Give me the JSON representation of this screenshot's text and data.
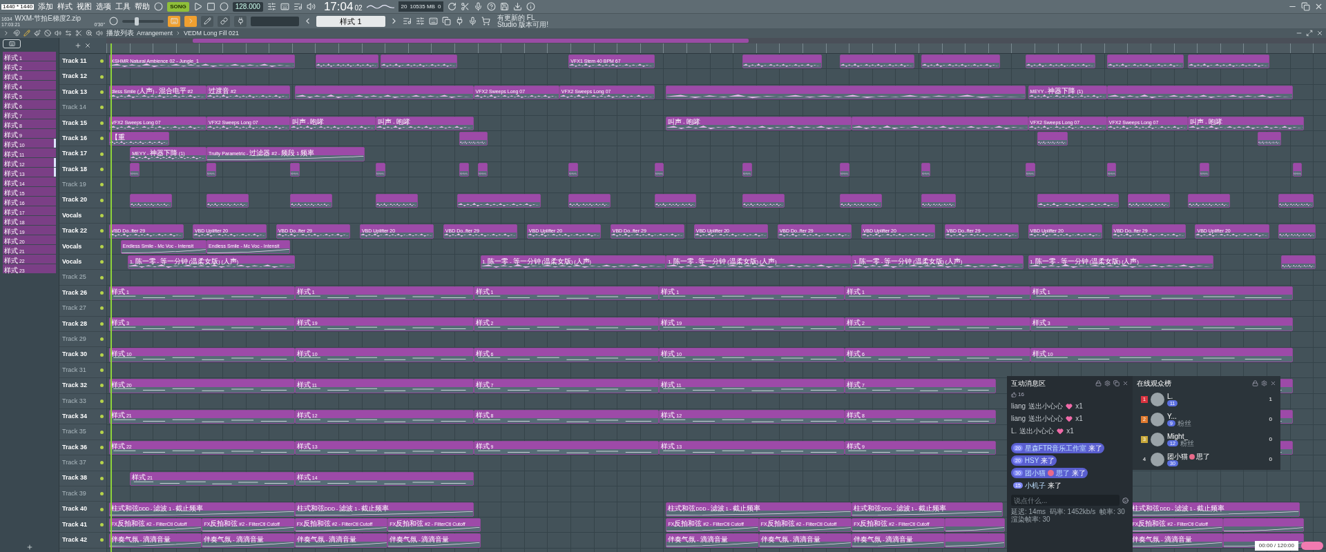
{
  "overlay_label": "1440 * 1440",
  "menu": [
    "添加",
    "样式",
    "视图",
    "选项",
    "工具",
    "帮助"
  ],
  "transport": {
    "mode": "SONG",
    "song_on": true,
    "tempo": "128.000",
    "time": "17:04",
    "seconds": "02",
    "cpu": "20",
    "memory": "10535 MB",
    "polyphony": "0"
  },
  "hint": [
    "有更新的 FL",
    "Studio 版本可用!"
  ],
  "file": {
    "index": "1634",
    "name": "WXM-节拍E梯度2.zip",
    "clock": "17:03:21",
    "position": "0'30\""
  },
  "main_volume": {
    "level": 0.35
  },
  "tool_toggles": [
    {
      "on": true
    },
    {
      "on": true
    },
    {
      "on": false
    },
    {
      "on": false
    },
    {
      "on": false
    }
  ],
  "pattern_selector": "样式 1",
  "playlist_title": {
    "name": "播放列表",
    "view": "Arrangement",
    "pattern": "VEDM Long Fill 021"
  },
  "patterns": [
    {
      "label": "样式 1",
      "marked": false
    },
    {
      "label": "样式 2",
      "marked": false
    },
    {
      "label": "样式 3",
      "marked": false
    },
    {
      "label": "样式 4",
      "marked": false
    },
    {
      "label": "样式 5",
      "marked": false
    },
    {
      "label": "样式 6",
      "marked": false
    },
    {
      "label": "样式 7",
      "marked": false
    },
    {
      "label": "样式 8",
      "marked": false
    },
    {
      "label": "样式 9",
      "marked": false
    },
    {
      "label": "样式 10",
      "marked": true
    },
    {
      "label": "样式 11",
      "marked": false
    },
    {
      "label": "样式 12",
      "marked": true
    },
    {
      "label": "样式 13",
      "marked": true
    },
    {
      "label": "样式 14",
      "marked": false
    },
    {
      "label": "样式 15",
      "marked": false
    },
    {
      "label": "样式 16",
      "marked": false
    },
    {
      "label": "样式 17",
      "marked": false
    },
    {
      "label": "样式 18",
      "marked": false
    },
    {
      "label": "样式 19",
      "marked": false
    },
    {
      "label": "样式 20",
      "marked": false
    },
    {
      "label": "样式 21",
      "marked": false
    },
    {
      "label": "样式 22",
      "marked": false
    },
    {
      "label": "样式 23",
      "marked": false
    }
  ],
  "tracks": [
    {
      "name": "Track 11",
      "dimmed": false,
      "clips": [
        {
          "kind": "audio",
          "label": "KSHMR Natural Ambience 02 - Jungle_1"
        },
        {
          "kind": "audio"
        },
        {
          "kind": "audio"
        },
        {
          "kind": "audio",
          "label": "VFX1 Stem 40 BPM 67"
        },
        {
          "kind": "audio"
        },
        {
          "kind": "audio"
        },
        {
          "kind": "audio"
        },
        {
          "kind": "audio"
        },
        {
          "kind": "audio"
        },
        {
          "kind": "audio"
        }
      ]
    },
    {
      "name": "Track 12",
      "dimmed": false
    },
    {
      "name": "Track 13",
      "dimmed": false,
      "clips": [
        {
          "kind": "audio",
          "label": "dless Smile (人声) - 混合电平 #2"
        },
        {
          "kind": "audio",
          "label": "过渡音 #2"
        },
        {
          "kind": "audio"
        },
        {
          "kind": "audio",
          "label": "VFX2 Sweeps Long 07"
        },
        {
          "kind": "audio",
          "label": "VFX2 Sweeps Long 07"
        },
        {
          "kind": "audio"
        },
        {
          "kind": "audio",
          "label": "MEYY - 神器下降 (1)"
        },
        {
          "kind": "audio"
        }
      ]
    },
    {
      "name": "Track 14",
      "dimmed": true
    },
    {
      "name": "Track 15",
      "dimmed": false,
      "clips": [
        {
          "kind": "audio",
          "label": "VFX2 Sweeps Long 07"
        },
        {
          "kind": "audio",
          "label": "VFX2 Sweeps Long 07"
        },
        {
          "kind": "audio",
          "label": "叫声 - 咆哮"
        },
        {
          "kind": "audio",
          "label": "叫声 - 咆哮"
        },
        {
          "kind": "audio",
          "label": "叫声 - 咆哮"
        },
        {
          "kind": "audio"
        },
        {
          "kind": "audio",
          "label": "VFX2 Sweeps Long 07"
        },
        {
          "kind": "audio",
          "label": "VFX2 Sweeps Long 07"
        },
        {
          "kind": "audio",
          "label": "叫声 - 咆哮"
        }
      ]
    },
    {
      "name": "Track 16",
      "dimmed": false,
      "clips": [
        {
          "kind": "audio",
          "label": "【重"
        },
        {
          "kind": "audio"
        },
        {
          "kind": "audio"
        },
        {
          "kind": "audio"
        }
      ]
    },
    {
      "name": "Track 17",
      "dimmed": false,
      "clips": [
        {
          "kind": "audio",
          "label": "MEYY - 神器下降 (1)"
        },
        {
          "kind": "automation",
          "label": "Trulty Parametric - 过滤器 #2 - 频段 1 频率"
        }
      ]
    },
    {
      "name": "Track 18",
      "dimmed": false,
      "clips": [
        {
          "kind": "audio"
        },
        {
          "kind": "audio"
        },
        {
          "kind": "audio"
        },
        {
          "kind": "audio"
        },
        {
          "kind": "audio"
        },
        {
          "kind": "audio"
        },
        {
          "kind": "audio"
        },
        {
          "kind": "audio"
        },
        {
          "kind": "audio"
        },
        {
          "kind": "audio"
        },
        {
          "kind": "audio"
        },
        {
          "kind": "audio"
        },
        {
          "kind": "audio"
        },
        {
          "kind": "audio"
        },
        {
          "kind": "audio"
        }
      ]
    },
    {
      "name": "Track 19",
      "dimmed": true
    },
    {
      "name": "Track 20",
      "dimmed": false,
      "clips": [
        {
          "kind": "audio"
        },
        {
          "kind": "audio"
        },
        {
          "kind": "audio"
        },
        {
          "kind": "audio"
        },
        {
          "kind": "audio"
        },
        {
          "kind": "audio"
        },
        {
          "kind": "audio"
        },
        {
          "kind": "audio"
        },
        {
          "kind": "audio"
        },
        {
          "kind": "audio"
        },
        {
          "kind": "audio"
        },
        {
          "kind": "audio"
        },
        {
          "kind": "audio"
        },
        {
          "kind": "audio"
        }
      ]
    },
    {
      "name": "Vocals",
      "dimmed": false
    },
    {
      "name": "Track 22",
      "dimmed": false,
      "clips": [
        {
          "kind": "audio",
          "label": "VBD Do..fter 29"
        },
        {
          "kind": "audio",
          "label": "VBD Uplifter 20"
        },
        {
          "kind": "audio",
          "label": "VBD Do..fter 29"
        },
        {
          "kind": "audio",
          "label": "VBD Uplifter 20"
        },
        {
          "kind": "audio",
          "label": "VBD Do..fter 29"
        },
        {
          "kind": "audio",
          "label": "VBD Uplifter 20"
        },
        {
          "kind": "audio",
          "label": "VBD Do..fter 29"
        },
        {
          "kind": "audio",
          "label": "VBD Uplifter 20"
        },
        {
          "kind": "audio",
          "label": "VBD Do..fter 29"
        },
        {
          "kind": "audio",
          "label": "VBD Uplifter 20"
        },
        {
          "kind": "audio",
          "label": "VBD Do..fter 29"
        },
        {
          "kind": "audio",
          "label": "VBD Uplifter 20"
        },
        {
          "kind": "audio",
          "label": "VBD Do..fter 29"
        },
        {
          "kind": "audio",
          "label": "VBD Uplifter 20"
        },
        {
          "kind": "audio"
        }
      ]
    },
    {
      "name": "Vocals",
      "dimmed": false,
      "clips": [
        {
          "kind": "automation",
          "label": "Endless Smile - Mc Voc - Intensit"
        },
        {
          "kind": "automation",
          "label": "Endless Smile - Mc Voc - Intensit"
        }
      ]
    },
    {
      "name": "Vocals",
      "dimmed": false,
      "clips": [
        {
          "kind": "audio",
          "label": "1. 陈一零 - 等一分钟 (温柔女版) (人声)"
        },
        {
          "kind": "audio",
          "label": "1. 陈一零 - 等一分钟 (温柔女版) (人声)"
        },
        {
          "kind": "audio",
          "label": "1. 陈一零 - 等一分钟 (温柔女版) (人声)"
        },
        {
          "kind": "audio",
          "label": "1. 陈一零 - 等一分钟 (温柔女版) (人声)"
        },
        {
          "kind": "audio",
          "label": "1. 陈一零 - 等一分钟 (温柔女版) (人声)"
        },
        {
          "kind": "audio"
        }
      ]
    },
    {
      "name": "Track 25",
      "dimmed": true
    },
    {
      "name": "Track 26",
      "dimmed": false,
      "clips": [
        {
          "kind": "pattern",
          "label": "样式 1"
        },
        {
          "kind": "pattern",
          "label": "样式 1"
        },
        {
          "kind": "pattern",
          "label": "样式 1"
        },
        {
          "kind": "pattern",
          "label": "样式 1"
        },
        {
          "kind": "pattern",
          "label": "样式 1"
        },
        {
          "kind": "pattern",
          "label": "样式 1"
        }
      ]
    },
    {
      "name": "Track 27",
      "dimmed": true
    },
    {
      "name": "Track 28",
      "dimmed": false,
      "clips": [
        {
          "kind": "pattern",
          "label": "样式 3"
        },
        {
          "kind": "pattern",
          "label": "样式 19"
        },
        {
          "kind": "pattern",
          "label": "样式 2"
        },
        {
          "kind": "pattern",
          "label": "样式 19"
        },
        {
          "kind": "pattern",
          "label": "样式 2"
        },
        {
          "kind": "pattern",
          "label": "样式 3"
        }
      ]
    },
    {
      "name": "Track 29",
      "dimmed": true
    },
    {
      "name": "Track 30",
      "dimmed": false,
      "clips": [
        {
          "kind": "pattern",
          "label": "样式 10"
        },
        {
          "kind": "pattern",
          "label": "样式 10"
        },
        {
          "kind": "pattern",
          "label": "样式 6"
        },
        {
          "kind": "pattern",
          "label": "样式 10"
        },
        {
          "kind": "pattern",
          "label": "样式 6"
        },
        {
          "kind": "pattern",
          "label": "样式 10"
        }
      ]
    },
    {
      "name": "Track 31",
      "dimmed": true
    },
    {
      "name": "Track 32",
      "dimmed": false,
      "clips": [
        {
          "kind": "pattern",
          "label": "样式 20"
        },
        {
          "kind": "pattern",
          "label": "样式 11"
        },
        {
          "kind": "pattern",
          "label": "样式 7"
        },
        {
          "kind": "pattern",
          "label": "样式 11"
        },
        {
          "kind": "pattern",
          "label": "样式 7"
        },
        {
          "kind": "pattern"
        }
      ]
    },
    {
      "name": "Track 33",
      "dimmed": true
    },
    {
      "name": "Track 34",
      "dimmed": false,
      "clips": [
        {
          "kind": "pattern",
          "label": "样式 21"
        },
        {
          "kind": "pattern",
          "label": "样式 12"
        },
        {
          "kind": "pattern",
          "label": "样式 8"
        },
        {
          "kind": "pattern",
          "label": "样式 12"
        },
        {
          "kind": "pattern",
          "label": "样式 8"
        },
        {
          "kind": "pattern"
        }
      ]
    },
    {
      "name": "Track 35",
      "dimmed": true
    },
    {
      "name": "Track 36",
      "dimmed": false,
      "clips": [
        {
          "kind": "pattern",
          "label": "样式 22"
        },
        {
          "kind": "pattern",
          "label": "样式 13"
        },
        {
          "kind": "pattern",
          "label": "样式 9"
        },
        {
          "kind": "pattern",
          "label": "样式 13"
        },
        {
          "kind": "pattern",
          "label": "样式 9"
        },
        {
          "kind": "pattern"
        }
      ]
    },
    {
      "name": "Track 37",
      "dimmed": true
    },
    {
      "name": "Track 38",
      "dimmed": false,
      "clips": [
        {
          "kind": "pattern",
          "label": "样式 21"
        },
        {
          "kind": "pattern",
          "label": "样式 14"
        }
      ]
    },
    {
      "name": "Track 39",
      "dimmed": true
    },
    {
      "name": "Track 40",
      "dimmed": false,
      "clips": [
        {
          "kind": "automation",
          "label": "柱式和弦DDD - 滤波 1 - 截止频率"
        },
        {
          "kind": "automation",
          "label": "柱式和弦DDD - 滤波 1 - 截止频率"
        },
        {
          "kind": "automation",
          "label": "柱式和弦DDD - 滤波 1 - 截止频率"
        },
        {
          "kind": "automation",
          "label": "柱式和弦DDD - 滤波 1 - 截止频率"
        },
        {
          "kind": "automation",
          "label": "柱式和弦DDD - 滤波 1 - 截止频率"
        }
      ]
    },
    {
      "name": "Track 41",
      "dimmed": false,
      "clips": [
        {
          "kind": "automation",
          "label": "FX反拍和弦 #2 - FilterCtl Cutoff"
        },
        {
          "kind": "automation",
          "label": "FX反拍和弦 #2 - FilterCtl Cutoff"
        },
        {
          "kind": "automation",
          "label": "FX反拍和弦 #2 - FilterCtl Cutoff"
        },
        {
          "kind": "automation",
          "label": "FX反拍和弦 #2 - FilterCtl Cutoff"
        },
        {
          "kind": "automation",
          "label": "FX反拍和弦 #2 - FilterCtl Cutoff"
        },
        {
          "kind": "automation",
          "label": "FX反拍和弦 #2 - FilterCtl Cutoff"
        },
        {
          "kind": "automation",
          "label": "FX反拍和弦 #2 - FilterCtl Cutoff"
        },
        {
          "kind": "automation"
        },
        {
          "kind": "automation",
          "label": "FX反拍和弦 #2 - FilterCtl Cutoff"
        },
        {
          "kind": "automation"
        }
      ]
    },
    {
      "name": "Track 42",
      "dimmed": false,
      "clips": [
        {
          "kind": "automation",
          "label": "伴奏气氛 - 滴滴音量"
        },
        {
          "kind": "automation",
          "label": "伴奏气氛 - 滴滴音量"
        },
        {
          "kind": "automation",
          "label": "伴奏气氛 - 滴滴音量"
        },
        {
          "kind": "automation",
          "label": "伴奏气氛 - 滴滴音量"
        },
        {
          "kind": "automation",
          "label": "伴奏气氛 - 滴滴音量"
        },
        {
          "kind": "automation",
          "label": "伴奏气氛 - 滴滴音量"
        },
        {
          "kind": "automation",
          "label": "伴奏气氛 - 滴滴音量"
        },
        {
          "kind": "automation"
        },
        {
          "kind": "automation",
          "label": "伴奏气氛 - 滴滴音量"
        },
        {
          "kind": "automation"
        }
      ]
    }
  ],
  "chat": {
    "title": "互动消息区",
    "likes": "16",
    "gifts": [
      {
        "user": "liang",
        "action": "送出小心心",
        "count": "x1"
      },
      {
        "user": "liang",
        "action": "送出小心心",
        "count": "x1"
      },
      {
        "user": "L.",
        "action": "送出小心心",
        "count": "x1"
      }
    ],
    "entries": [
      {
        "level": "20",
        "user": "星森FTR音乐工作室",
        "action": "来了",
        "bubble": true
      },
      {
        "level": "20",
        "user": "HSY",
        "action": "来了",
        "bubble": true
      },
      {
        "level": "30",
        "user": "团小猫",
        "emoji": true,
        "suffix": "思了",
        "action": "来了",
        "bubble": true
      },
      {
        "level": "15",
        "user": "小机子",
        "action": "来了",
        "bubble": false
      }
    ],
    "placeholder": "说点什么...",
    "stats": [
      "延迟: 14ms",
      "码率: 1452kb/s",
      "帧率: 30",
      "渲染帧率: 30"
    ]
  },
  "audience": {
    "title": "在线观众榜",
    "rows": [
      {
        "kind": "medal",
        "rank": "1",
        "color": "#d9333f",
        "name": "L.",
        "level": "11",
        "score": "1"
      },
      {
        "kind": "medal",
        "rank": "2",
        "color": "#e07a2e",
        "name": "Y...",
        "level": "9",
        "tag": "粉丝",
        "score": "0"
      },
      {
        "kind": "medal",
        "rank": "3",
        "color": "#c9a93a",
        "name": "Might_",
        "level": "12",
        "tag": "粉丝",
        "score": "0"
      },
      {
        "kind": "plain",
        "rank": "4",
        "name": "团小猫",
        "emoji": true,
        "suffix": "思了",
        "level": "30",
        "score": "0"
      }
    ]
  },
  "player": {
    "time": "00:00 / 120:00"
  }
}
